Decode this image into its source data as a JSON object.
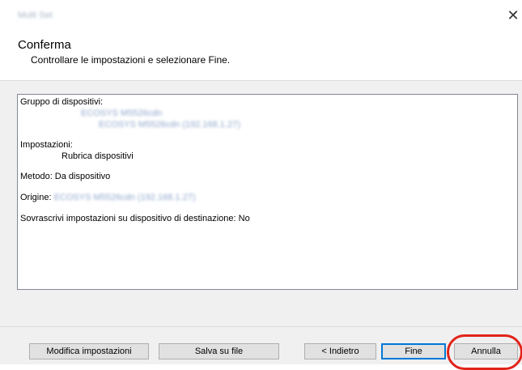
{
  "window": {
    "title": "Multi Set",
    "close_glyph": "✕"
  },
  "header": {
    "title": "Conferma",
    "subtitle": "Controllare le impostazioni e selezionare Fine."
  },
  "summary": {
    "device_group_label": "Gruppo di dispositivi:",
    "device_group_name": "ECOSYS M5526cdn",
    "device_group_entry": "ECOSYS M5526cdn (192.168.1.27)",
    "settings_label": "Impostazioni:",
    "settings_value": "Rubrica dispositivi",
    "method": "Metodo: Da dispositivo",
    "origin_label": "Origine:",
    "origin_value": "ECOSYS M5526cdn (192.168.1.27)",
    "overwrite": "Sovrascrivi impostazioni su dispositivo di destinazione: No"
  },
  "buttons": {
    "edit_settings": "Modifica impostazioni",
    "save_to_file": "Salva su file",
    "back": "< Indietro",
    "finish": "Fine",
    "cancel": "Annulla"
  },
  "colors": {
    "highlight": "#e2231a",
    "focus": "#0078d7"
  }
}
